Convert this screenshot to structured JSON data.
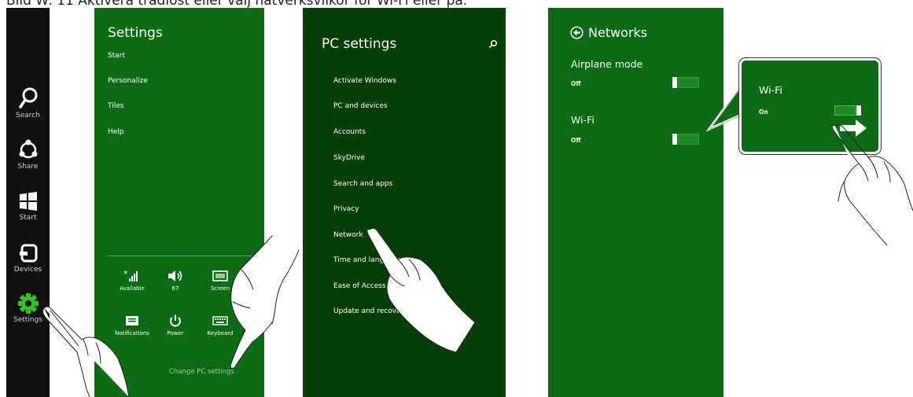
{
  "caption": "Bild W: 11 Aktivera trådlöst eller välj nätverksvilkor för Wi-Fi eller på.",
  "charms": [
    {
      "label": "Search",
      "icon": "search-icon"
    },
    {
      "label": "Share",
      "icon": "share-icon"
    },
    {
      "label": "Start",
      "icon": "windows-logo-icon"
    },
    {
      "label": "Devices",
      "icon": "devices-icon"
    },
    {
      "label": "Settings",
      "icon": "gear-icon"
    }
  ],
  "settings": {
    "title": "Settings",
    "items": [
      "Start",
      "Personalize",
      "Tiles",
      "Help"
    ],
    "tiles": [
      {
        "label": "Available",
        "icon": "wifi-signal-icon"
      },
      {
        "label": "67",
        "icon": "volume-icon"
      },
      {
        "label": "Screen",
        "icon": "screen-icon"
      },
      {
        "label": "Notifications",
        "icon": "notifications-icon"
      },
      {
        "label": "Power",
        "icon": "power-icon"
      },
      {
        "label": "Keyboard",
        "icon": "keyboard-icon"
      }
    ],
    "change_link": "Change PC settings"
  },
  "pc_settings": {
    "title": "PC settings",
    "items": [
      "Activate Windows",
      "PC and devices",
      "Accounts",
      "SkyDrive",
      "Search and apps",
      "Privacy",
      "Network",
      "Time and language",
      "Ease of Access",
      "Update and recovery"
    ]
  },
  "networks": {
    "title": "Networks",
    "airplane_label": "Airplane mode",
    "airplane_state": "Off",
    "wifi_label": "Wi-Fi",
    "wifi_state": "Off"
  },
  "callout": {
    "wifi_label": "Wi-Fi",
    "wifi_state": "On"
  },
  "colors": {
    "panel_green": "#0d6b15",
    "dark_green": "#053f08",
    "charms_bg": "#111111",
    "settings_gear": "#2fc61f"
  }
}
